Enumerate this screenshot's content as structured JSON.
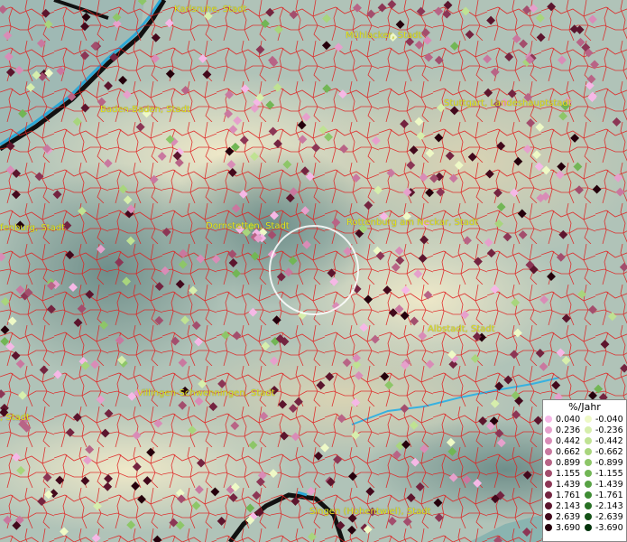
{
  "legend": {
    "unit": "%/Jahr",
    "positive": [
      "0.040",
      "0.236",
      "0.442",
      "0.662",
      "0.899",
      "1.155",
      "1.439",
      "1.761",
      "2.143",
      "2.639",
      "3.690"
    ],
    "negative": [
      "-0.040",
      "-0.236",
      "-0.442",
      "-0.662",
      "-0.899",
      "-1.155",
      "-1.439",
      "-1.761",
      "-2.143",
      "-2.639",
      "-3.690"
    ],
    "positive_colors": [
      "#f5b8e6",
      "#e6a0cc",
      "#d98cb7",
      "#c9789f",
      "#b86486",
      "#a34e6d",
      "#8c3655",
      "#742440",
      "#5c152d",
      "#43091c",
      "#25000c"
    ],
    "negative_colors": [
      "#eef9c6",
      "#d6eeac",
      "#bfe293",
      "#a8d57d",
      "#8dc668",
      "#72b655",
      "#58a244",
      "#3e8c33",
      "#287024",
      "#145217",
      "#03330c"
    ]
  },
  "cities": [
    {
      "name": "Karlsruhe, Stadt"
    },
    {
      "name": "Mühlacker, Stadt"
    },
    {
      "name": "Baden-Baden, Stadt"
    },
    {
      "name": "Stuttgart, Landeshauptstadt"
    },
    {
      "name": "Dornstetten, Stadt"
    },
    {
      "name": "Rottenburg am Neckar, Stadt"
    },
    {
      "name": "fenburg, Stadt"
    },
    {
      "name": "Albstadt, Stadt"
    },
    {
      "name": "Villingen-Schwenningen, Stadt"
    },
    {
      "name": ", Stadt"
    },
    {
      "name": "Singen (Hohentwiel), Stadt"
    }
  ],
  "colors": {
    "city_label": "#e6e61a",
    "boundary_lines": "#e02020",
    "rhine": "#2aa7d6",
    "water": "#37b1e0",
    "selection_circle": "#ffffff"
  }
}
